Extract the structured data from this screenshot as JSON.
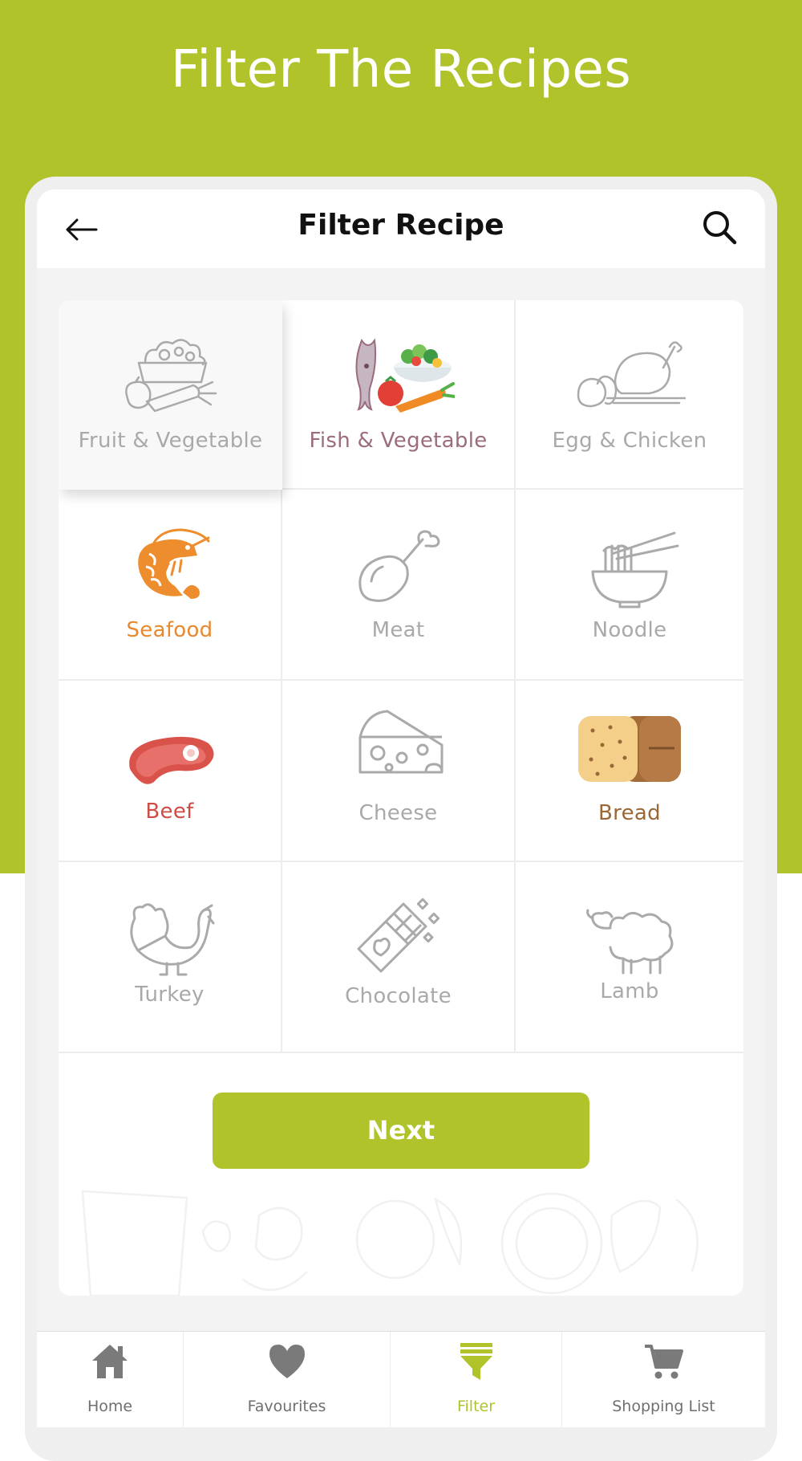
{
  "hero": {
    "title": "Filter The Recipes"
  },
  "appbar": {
    "title": "Filter Recipe",
    "back_icon": "arrow-left-icon",
    "search_icon": "search-icon"
  },
  "categories": [
    {
      "label": "Fruit & Vegetable",
      "icon": "fruit-vegetable-icon",
      "selected": true
    },
    {
      "label": "Fish & Vegetable",
      "icon": "fish-vegetable-icon",
      "color": "#9b6b7e"
    },
    {
      "label": "Egg & Chicken",
      "icon": "egg-chicken-icon"
    },
    {
      "label": "Seafood",
      "icon": "shrimp-icon",
      "color": "#e8892e"
    },
    {
      "label": "Meat",
      "icon": "drumstick-icon"
    },
    {
      "label": "Noodle",
      "icon": "noodle-bowl-icon"
    },
    {
      "label": "Beef",
      "icon": "steak-icon",
      "color": "#cf4b44"
    },
    {
      "label": "Cheese",
      "icon": "cheese-icon"
    },
    {
      "label": "Bread",
      "icon": "bread-icon",
      "color": "#9a6736"
    },
    {
      "label": "Turkey",
      "icon": "turkey-icon"
    },
    {
      "label": "Chocolate",
      "icon": "chocolate-icon"
    },
    {
      "label": "Lamb",
      "icon": "sheep-icon"
    }
  ],
  "actions": {
    "next_label": "Next"
  },
  "tabs": [
    {
      "label": "Home",
      "icon": "home-icon"
    },
    {
      "label": "Favourites",
      "icon": "heart-icon"
    },
    {
      "label": "Filter",
      "icon": "filter-icon",
      "active": true
    },
    {
      "label": "Shopping List",
      "icon": "cart-icon"
    }
  ],
  "colors": {
    "accent": "#b1c32a",
    "inactive_icon": "#a9a9a9",
    "title": "#111111"
  }
}
